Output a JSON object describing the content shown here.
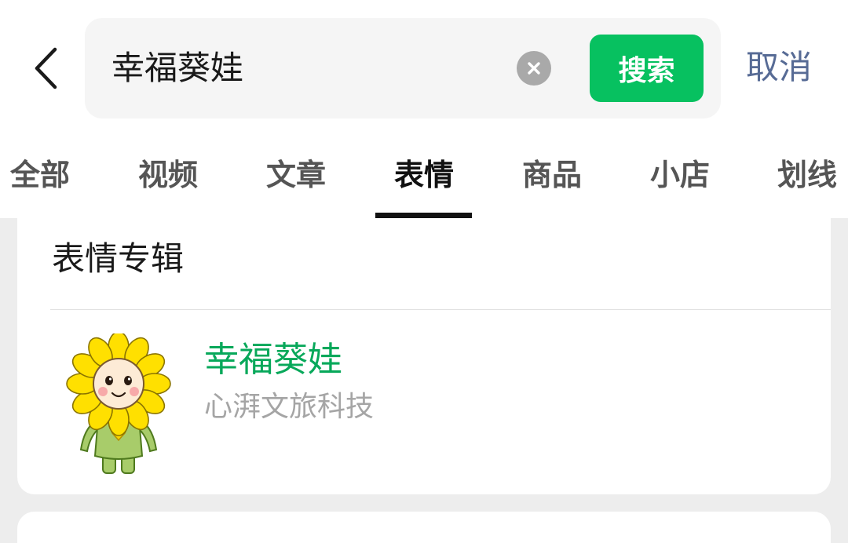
{
  "header": {
    "back_icon": "chevron-left-icon",
    "search": {
      "query": "幸福葵娃",
      "clear_icon": "clear-icon"
    },
    "search_button": "搜索",
    "cancel_label": "取消"
  },
  "tabs": [
    {
      "label": "全部",
      "active": false
    },
    {
      "label": "视频",
      "active": false
    },
    {
      "label": "文章",
      "active": false
    },
    {
      "label": "表情",
      "active": true
    },
    {
      "label": "商品",
      "active": false
    },
    {
      "label": "小店",
      "active": false
    },
    {
      "label": "划线",
      "active": false
    }
  ],
  "section": {
    "title": "表情专辑",
    "items": [
      {
        "name": "幸福葵娃",
        "subtitle": "心湃文旅科技",
        "image": "sunflower-mascot"
      }
    ]
  },
  "colors": {
    "accent_green": "#07c160",
    "link_blue": "#576b95",
    "title_green": "#07a85a"
  }
}
